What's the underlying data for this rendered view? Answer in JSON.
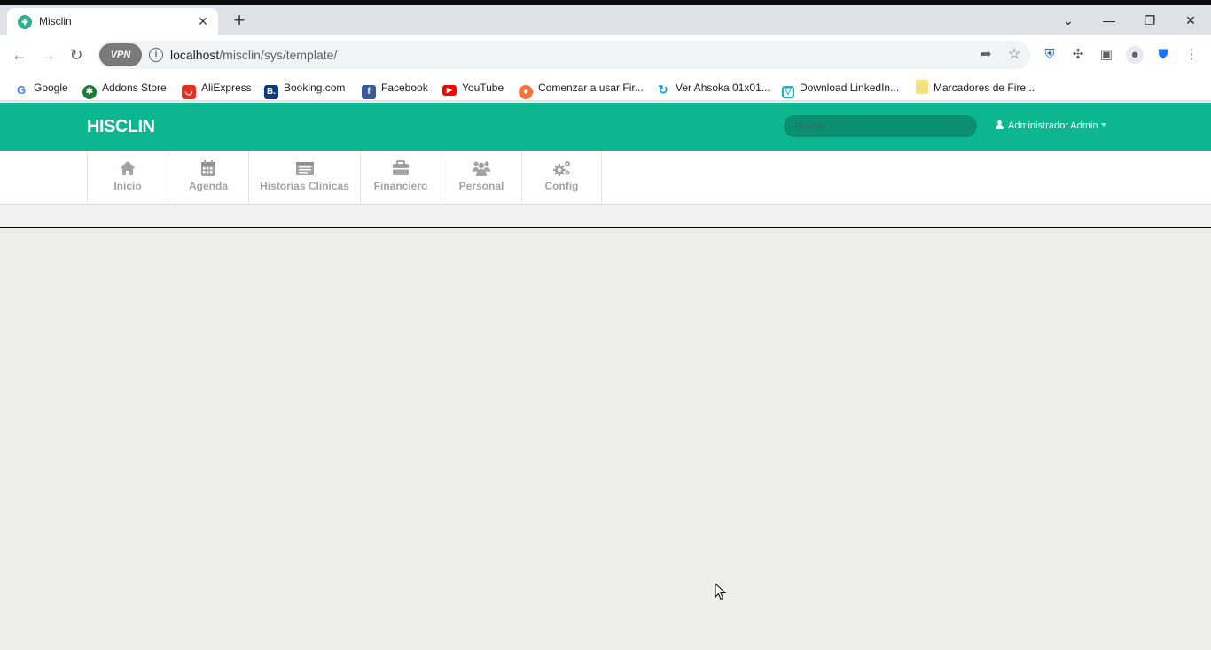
{
  "browser": {
    "tab_title": "Misclin",
    "tab_favicon": "tooth-icon",
    "url_host": "localhost",
    "url_path": "/misclin/sys/template/",
    "vpn_label": "VPN",
    "bookmarks": [
      {
        "label": "Google",
        "icon": "google-icon"
      },
      {
        "label": "Addons Store",
        "icon": "addons-store-icon"
      },
      {
        "label": "AliExpress",
        "icon": "aliexpress-icon"
      },
      {
        "label": "Booking.com",
        "icon": "booking-icon"
      },
      {
        "label": "Facebook",
        "icon": "facebook-icon"
      },
      {
        "label": "YouTube",
        "icon": "youtube-icon"
      },
      {
        "label": "Comenzar a usar Fir...",
        "icon": "firefox-icon"
      },
      {
        "label": "Ver Ahsoka 01x01...",
        "icon": "loading-icon"
      },
      {
        "label": "Download LinkedIn...",
        "icon": "linkedin-download-icon"
      },
      {
        "label": "Marcadores de Fire...",
        "icon": "folder-icon"
      }
    ]
  },
  "app": {
    "brand": "HISCLIN",
    "search_placeholder": "Buscar...",
    "user_label": "Administrador Admin",
    "accent_color": "#0cb68e",
    "menu": [
      {
        "label": "Inicio",
        "icon": "home-icon"
      },
      {
        "label": "Agenda",
        "icon": "calendar-icon"
      },
      {
        "label": "Historias Clinicas",
        "icon": "list-card-icon"
      },
      {
        "label": "Financiero",
        "icon": "briefcase-icon"
      },
      {
        "label": "Personal",
        "icon": "users-icon"
      },
      {
        "label": "Config",
        "icon": "gears-icon"
      }
    ]
  }
}
